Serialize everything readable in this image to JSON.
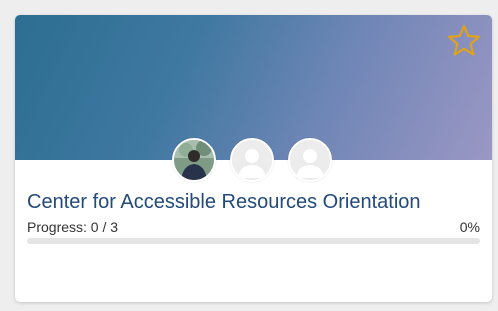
{
  "course": {
    "title": "Center for Accessible Resources Orientation",
    "progress_text": "Progress: 0 / 3",
    "progress_percent_text": "0%",
    "progress_fraction": 0,
    "favorite_icon": "star-outline-icon",
    "favorite_color": "#e0a21a"
  },
  "members": [
    {
      "type": "photo"
    },
    {
      "type": "placeholder"
    },
    {
      "type": "placeholder"
    }
  ]
}
